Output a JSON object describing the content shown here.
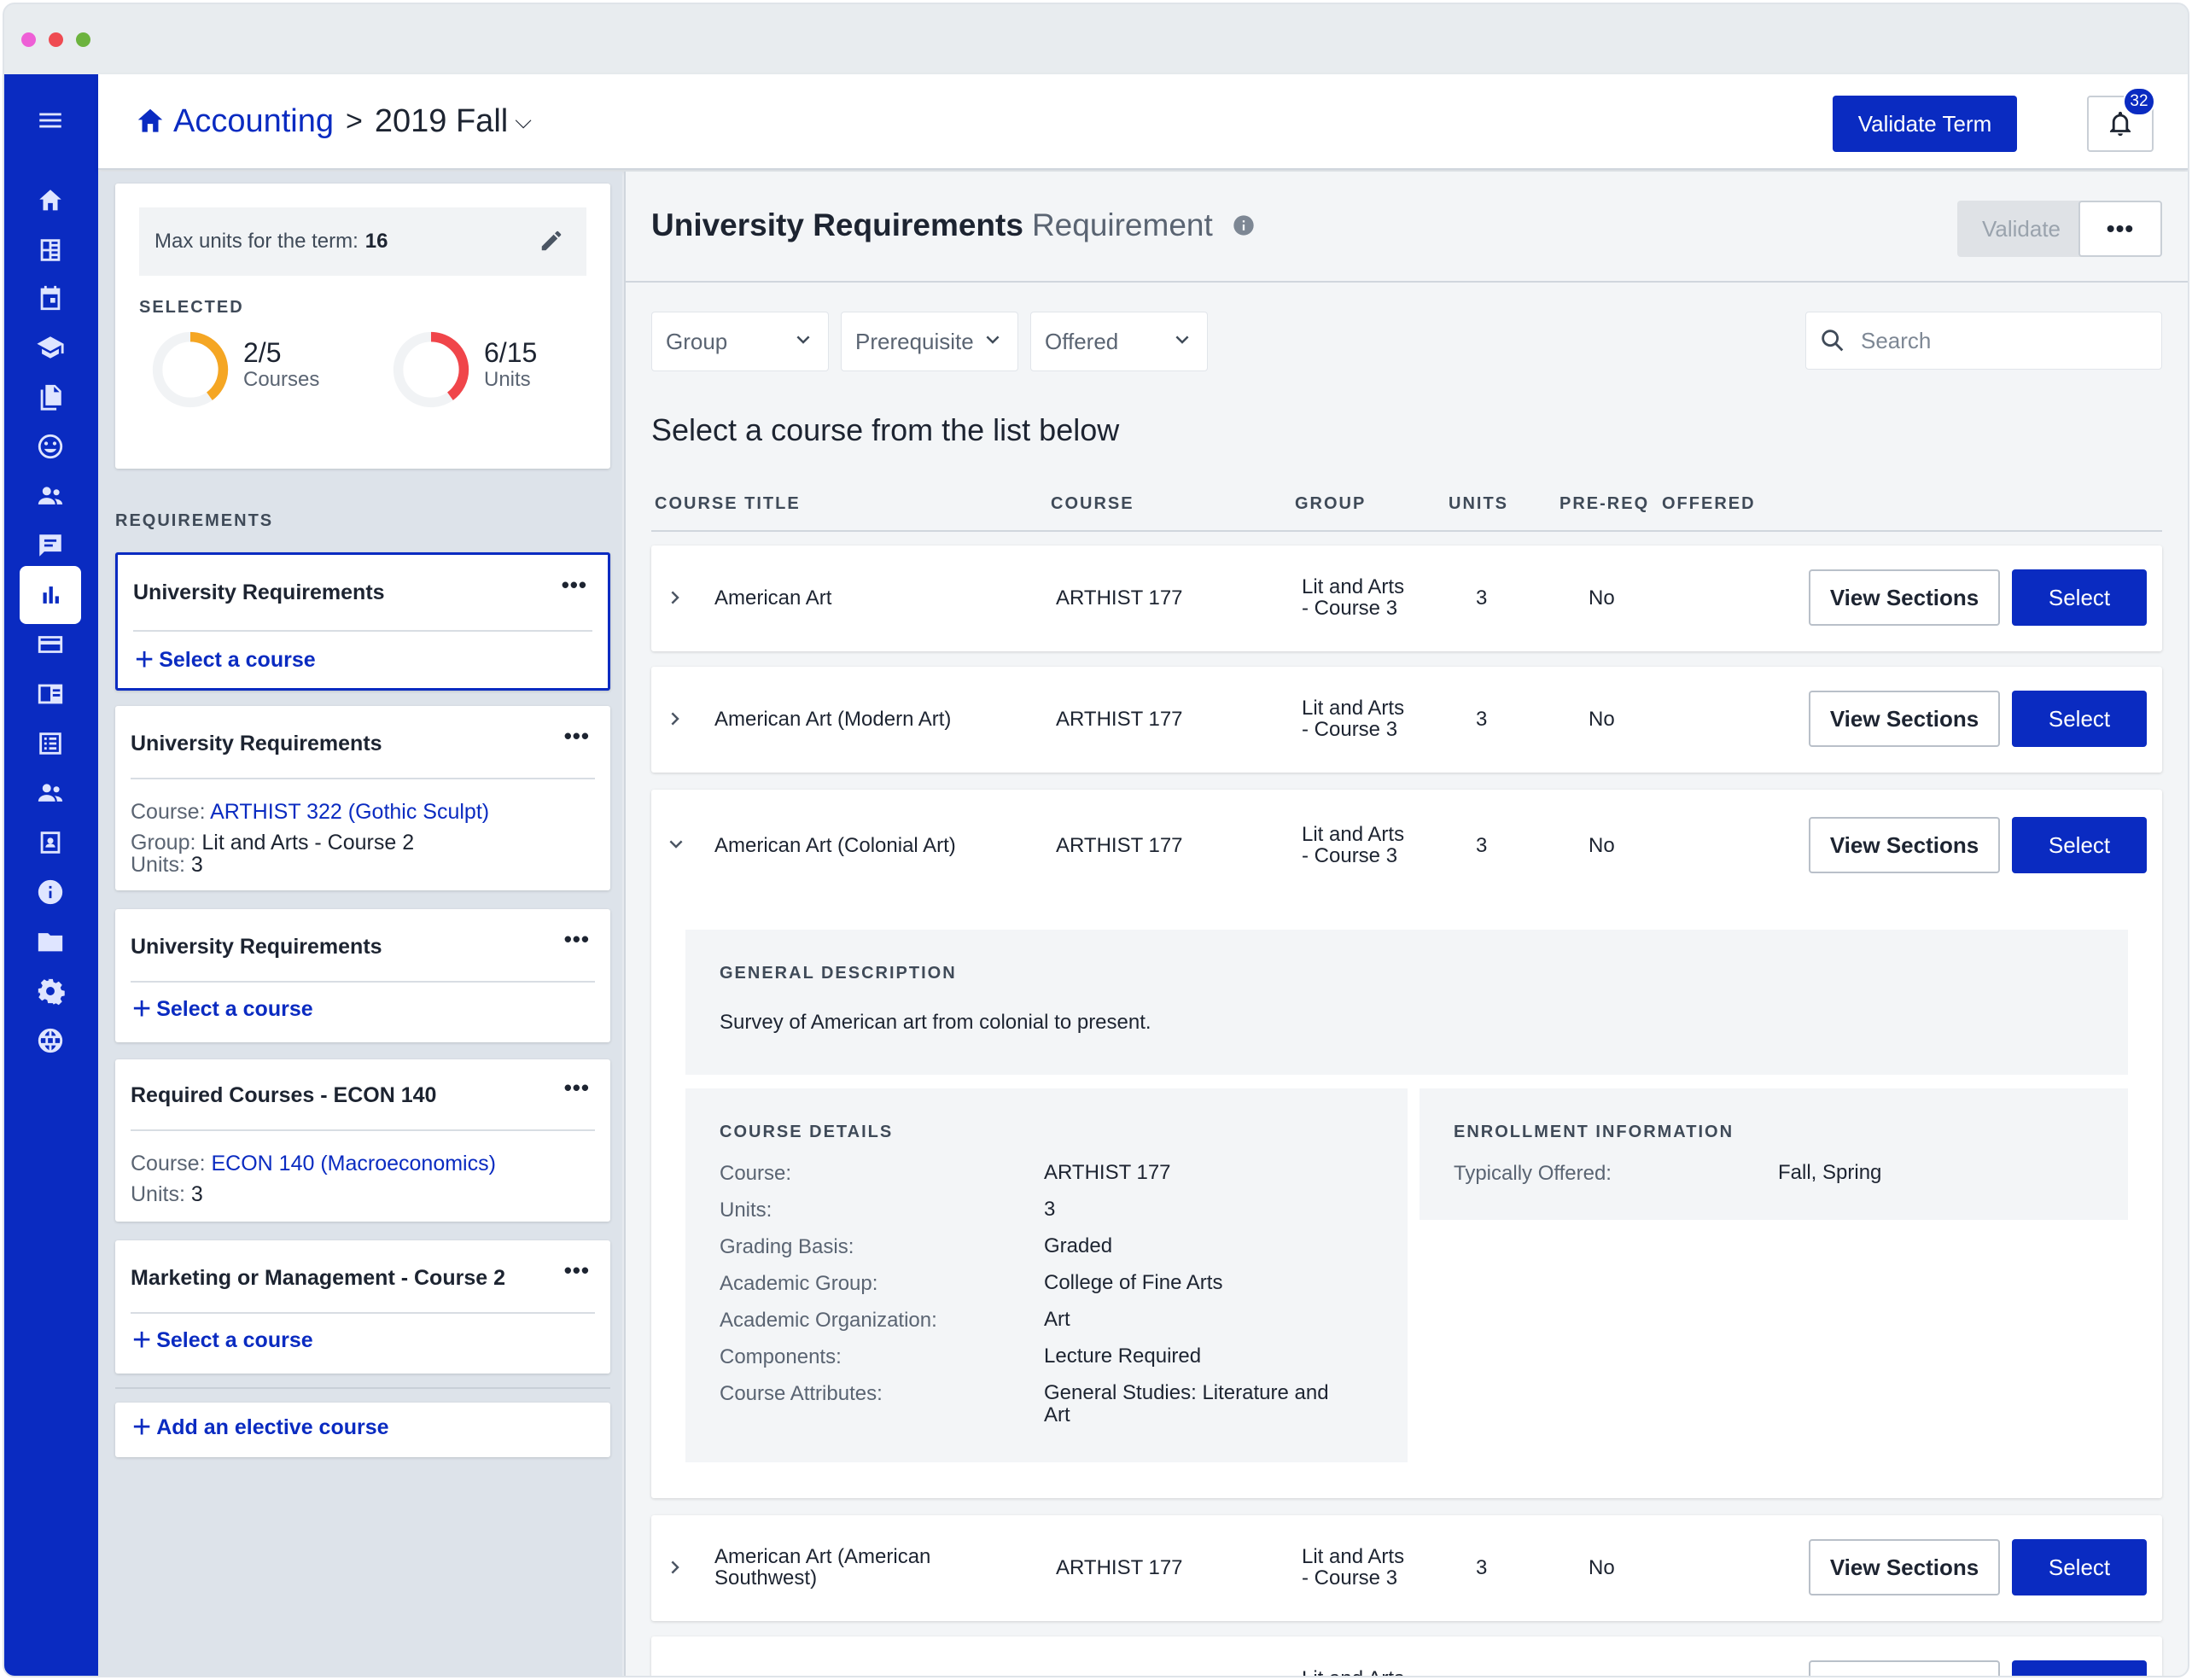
{
  "header": {
    "breadcrumb_program": "Accounting",
    "breadcrumb_sep": ">",
    "term": "2019 Fall",
    "validate_term": "Validate Term",
    "notification_count": "32"
  },
  "units_summary": {
    "max_units_label": "Max units for the term:",
    "max_units_value": "16",
    "selected_label": "SELECTED",
    "courses_value": "2/5",
    "courses_label": "Courses",
    "courses_fraction": 0.4,
    "units_value": "6/15",
    "units_label": "Units",
    "units_fraction": 0.4
  },
  "requirements": {
    "label": "REQUIREMENTS",
    "cards": [
      {
        "title": "University Requirements",
        "action": "Select a course"
      },
      {
        "title": "University Requirements",
        "course_label": "Course:",
        "course_link": "ARTHIST 322 (Gothic Sculpt)",
        "group_label": "Group:",
        "group_value": "Lit and Arts - Course 2",
        "units_label": "Units:",
        "units_value": "3"
      },
      {
        "title": "University Requirements",
        "action": "Select a course"
      },
      {
        "title": "Required Courses - ECON 140",
        "course_label": "Course:",
        "course_link": "ECON 140 (Macroeconomics)",
        "units_label": "Units:",
        "units_value": "3"
      },
      {
        "title": "Marketing or Management - Course 2",
        "action": "Select a course"
      }
    ],
    "add_elective": "Add an elective course",
    "more": "•••"
  },
  "main": {
    "title": "University Requirements",
    "subtitle": "Requirement",
    "validate": "Validate",
    "more": "•••",
    "filters": [
      "Group",
      "Prerequisite",
      "Offered"
    ],
    "search_placeholder": "Search",
    "instruction": "Select a course from the list below",
    "columns": [
      "COURSE TITLE",
      "COURSE",
      "GROUP",
      "UNITS",
      "PRE-REQ",
      "OFFERED"
    ],
    "view_sections": "View Sections",
    "select": "Select",
    "courses": [
      {
        "title": "American Art",
        "course": "ARTHIST 177",
        "group_l1": "Lit and Arts",
        "group_l2": "- Course 3",
        "units": "3",
        "prereq": "No"
      },
      {
        "title": "American Art (Modern Art)",
        "course": "ARTHIST 177",
        "group_l1": "Lit and Arts",
        "group_l2": "- Course 3",
        "units": "3",
        "prereq": "No"
      },
      {
        "title": "American Art (Colonial Art)",
        "course": "ARTHIST 177",
        "group_l1": "Lit and Arts",
        "group_l2": "- Course 3",
        "units": "3",
        "prereq": "No"
      },
      {
        "title_l1": "American Art (American",
        "title_l2": "Southwest)",
        "course": "ARTHIST 177",
        "group_l1": "Lit and Arts",
        "group_l2": "- Course 3",
        "units": "3",
        "prereq": "No"
      },
      {
        "group_l1": "Lit and Arts"
      }
    ],
    "expanded": {
      "general_label": "GENERAL DESCRIPTION",
      "general_text": "Survey of American art from colonial to present.",
      "details_label": "COURSE DETAILS",
      "details": [
        {
          "k": "Course:",
          "v": "ARTHIST 177"
        },
        {
          "k": "Units:",
          "v": "3"
        },
        {
          "k": "Grading Basis:",
          "v": "Graded"
        },
        {
          "k": "Academic Group:",
          "v": "College of Fine Arts"
        },
        {
          "k": "Academic Organization:",
          "v": "Art"
        },
        {
          "k": "Components:",
          "v": "Lecture Required"
        },
        {
          "k": "Course Attributes:",
          "v_l1": "General Studies: Literature and",
          "v_l2": "Art"
        }
      ],
      "enroll_label": "ENROLLMENT INFORMATION",
      "typically_offered_label": "Typically Offered:",
      "typically_offered_value": "Fall, Spring"
    }
  },
  "colors": {
    "brand": "#0a2bc1",
    "donut_courses": "#f5a623",
    "donut_units": "#f0454a"
  }
}
